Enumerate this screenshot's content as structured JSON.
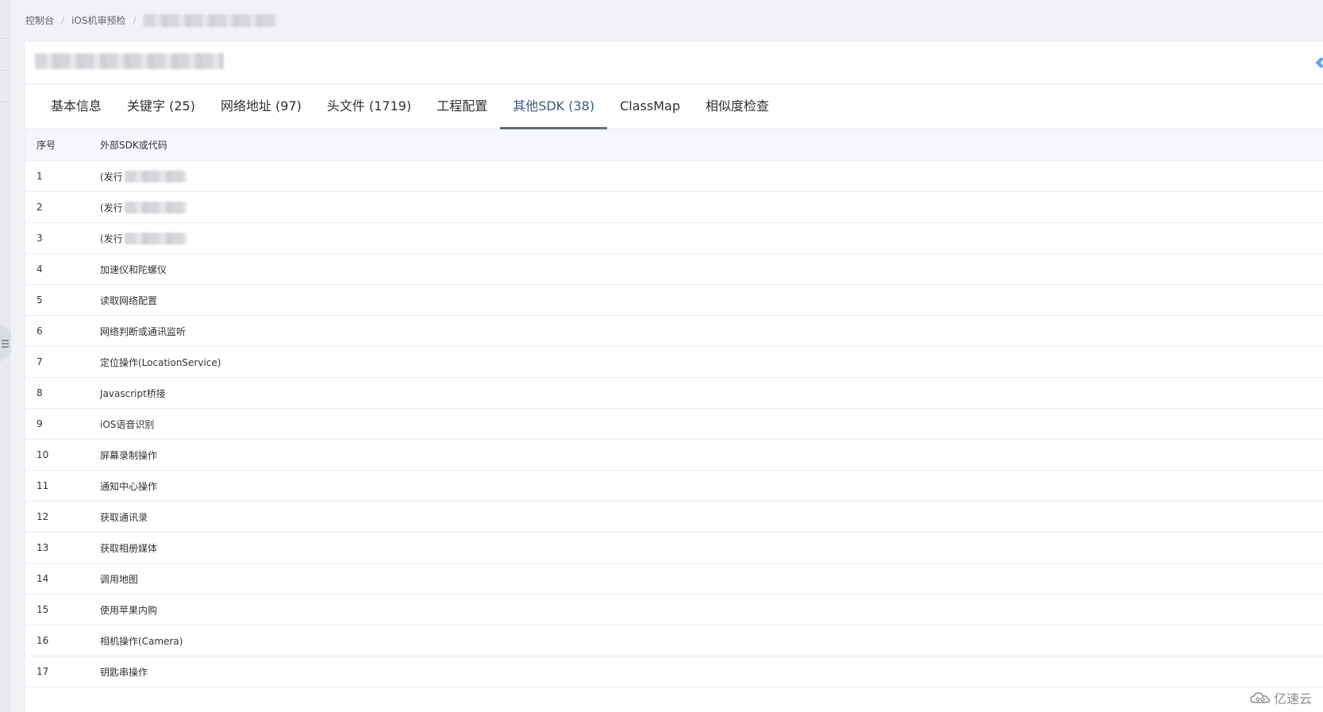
{
  "breadcrumb": {
    "items": [
      "控制台",
      "iOS机审预检"
    ],
    "separator": "/"
  },
  "tabs": [
    {
      "label": "基本信息",
      "active": false
    },
    {
      "label": "关键字 (25)",
      "active": false
    },
    {
      "label": "网络地址 (97)",
      "active": false
    },
    {
      "label": "头文件 (1719)",
      "active": false
    },
    {
      "label": "工程配置",
      "active": false
    },
    {
      "label": "其他SDK (38)",
      "active": true
    },
    {
      "label": "ClassMap",
      "active": false
    },
    {
      "label": "相似度检查",
      "active": false
    }
  ],
  "table": {
    "columns": [
      "序号",
      "外部SDK或代码"
    ],
    "rows": [
      {
        "index": "1",
        "name": "(发行",
        "redacted": true
      },
      {
        "index": "2",
        "name": "(发行",
        "redacted": true
      },
      {
        "index": "3",
        "name": "(发行",
        "redacted": true
      },
      {
        "index": "4",
        "name": "加速仪和陀螺仪"
      },
      {
        "index": "5",
        "name": "读取网络配置"
      },
      {
        "index": "6",
        "name": "网络判断或通讯监听"
      },
      {
        "index": "7",
        "name": "定位操作(LocationService)"
      },
      {
        "index": "8",
        "name": "Javascript桥接"
      },
      {
        "index": "9",
        "name": "iOS语音识别"
      },
      {
        "index": "10",
        "name": "屏幕录制操作"
      },
      {
        "index": "11",
        "name": "通知中心操作"
      },
      {
        "index": "12",
        "name": "获取通讯录"
      },
      {
        "index": "13",
        "name": "获取相册媒体"
      },
      {
        "index": "14",
        "name": "调用地图"
      },
      {
        "index": "15",
        "name": "使用苹果内购"
      },
      {
        "index": "16",
        "name": "相机操作(Camera)"
      },
      {
        "index": "17",
        "name": "钥匙串操作"
      }
    ]
  },
  "watermark": {
    "text": "亿速云",
    "icon": "cloud-logo-icon"
  },
  "colors": {
    "active_tab_text": "#3d5a80",
    "active_tab_underline": "#666b73",
    "back_icon": "#409eff"
  }
}
